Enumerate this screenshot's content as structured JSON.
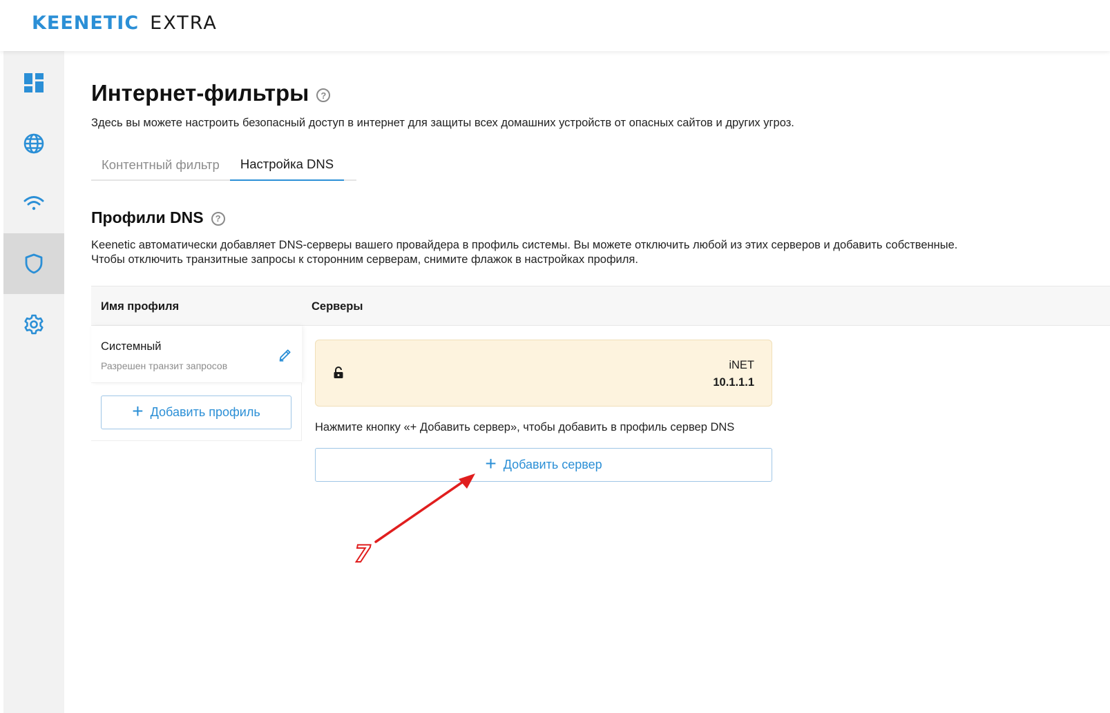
{
  "header": {
    "brand": "KEENETIC",
    "model": "EXTRA"
  },
  "sidebar": {
    "items": [
      {
        "name": "dashboard",
        "icon": "dashboard-icon",
        "active": false
      },
      {
        "name": "internet",
        "icon": "globe-icon",
        "active": false
      },
      {
        "name": "wifi",
        "icon": "wifi-icon",
        "active": false
      },
      {
        "name": "security",
        "icon": "shield-icon",
        "active": true
      },
      {
        "name": "settings",
        "icon": "gear-icon",
        "active": false
      }
    ]
  },
  "page": {
    "title": "Интернет-фильтры",
    "description": "Здесь вы можете настроить безопасный доступ в интернет для защиты всех домашних устройств от опасных сайтов и других угроз."
  },
  "tabs": [
    {
      "label": "Контентный фильтр",
      "active": false
    },
    {
      "label": "Настройка DNS",
      "active": true
    }
  ],
  "section": {
    "title": "Профили DNS",
    "description_line1": "Keenetic автоматически добавляет DNS-серверы вашего провайдера в профиль системы. Вы можете отключить любой из этих серверов и добавить собственные.",
    "description_line2": "Чтобы отключить транзитные запросы к сторонним серверам, снимите флажок в настройках профиля."
  },
  "table": {
    "col_profile": "Имя профиля",
    "col_servers": "Серверы"
  },
  "profile": {
    "name": "Системный",
    "subtitle": "Разрешен транзит запросов"
  },
  "add_profile_label": "Добавить профиль",
  "server": {
    "name": "iNET",
    "ip": "10.1.1.1"
  },
  "hint": "Нажмите кнопку «+ Добавить сервер», чтобы добавить в профиль сервер DNS",
  "add_server_label": "Добавить сервер",
  "annotation": {
    "number": "7"
  },
  "colors": {
    "accent": "#2b8fd6",
    "server_card_bg": "#fdf3de",
    "annotation": "#e01e1e"
  }
}
